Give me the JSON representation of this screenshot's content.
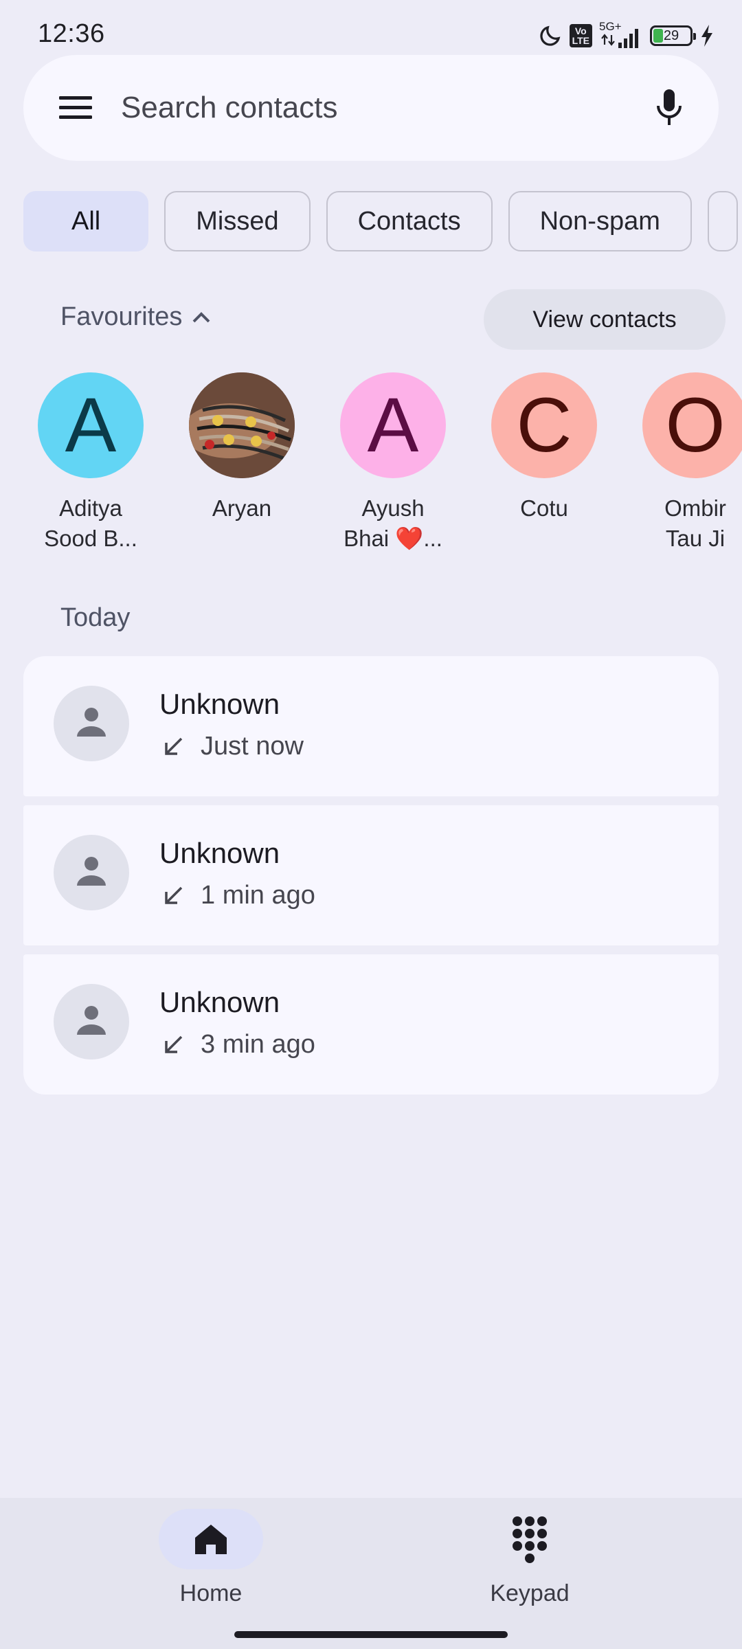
{
  "status_bar": {
    "time": "12:36",
    "network": "5G+",
    "volte": "Vo LTE",
    "battery": "29",
    "icons": [
      "moon-icon",
      "volte-icon",
      "signal-icon",
      "battery-icon",
      "charging-icon"
    ]
  },
  "search": {
    "placeholder": "Search contacts",
    "menu_icon": "menu-icon",
    "mic_icon": "mic-icon"
  },
  "chips": [
    {
      "label": "All",
      "selected": true
    },
    {
      "label": "Missed",
      "selected": false
    },
    {
      "label": "Contacts",
      "selected": false
    },
    {
      "label": "Non-spam",
      "selected": false
    }
  ],
  "favourites": {
    "title": "Favourites",
    "view_contacts_label": "View contacts",
    "items": [
      {
        "name_line1": "Aditya",
        "name_line2": "Sood B...",
        "initial": "A",
        "bg": "#62d5f4",
        "fg": "#0b3a48"
      },
      {
        "name_line1": "Aryan",
        "name_line2": "",
        "initial": "",
        "photo": true
      },
      {
        "name_line1": "Ayush",
        "name_line2": "Bhai ❤️...",
        "initial": "A",
        "bg": "#fdb1e8",
        "fg": "#5b0d44"
      },
      {
        "name_line1": "Cotu",
        "name_line2": "",
        "initial": "C",
        "bg": "#fcb2aa",
        "fg": "#4a0f0a"
      },
      {
        "name_line1": "Ombir",
        "name_line2": "Tau Ji",
        "initial": "O",
        "bg": "#fcb2aa",
        "fg": "#4a0f0a"
      }
    ]
  },
  "today": {
    "title": "Today",
    "calls": [
      {
        "name": "Unknown",
        "time": "Just now",
        "direction": "incoming"
      },
      {
        "name": "Unknown",
        "time": "1 min ago",
        "direction": "incoming"
      },
      {
        "name": "Unknown",
        "time": "3 min ago",
        "direction": "incoming"
      }
    ]
  },
  "bottom_nav": {
    "home_label": "Home",
    "keypad_label": "Keypad",
    "active": "Home"
  },
  "colors": {
    "background": "#edecf7",
    "surface": "#f8f7ff",
    "chip_selected": "#dde0f8"
  }
}
